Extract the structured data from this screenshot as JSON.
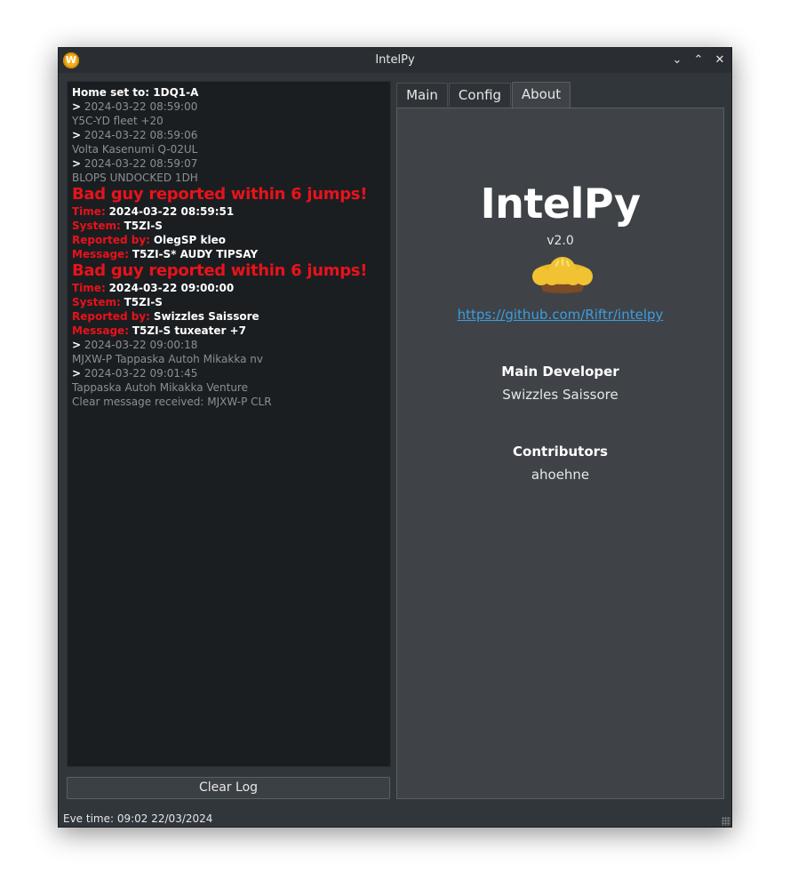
{
  "window": {
    "title": "IntelPy",
    "app_icon_letter": "W",
    "controls": {
      "minimize": "⌄",
      "maximize": "⌃",
      "close": "✕"
    }
  },
  "log": {
    "home_line": "Home set to: 1DQ1-A",
    "entries": [
      {
        "prefix": ">",
        "time": "2024-03-22 08:59:00",
        "text": "Y5C-YD fleet +20"
      },
      {
        "prefix": ">",
        "time": "2024-03-22 08:59:06",
        "text": "Volta Kasenumi Q-02UL"
      },
      {
        "prefix": ">",
        "time": "2024-03-22 08:59:07",
        "text": "BLOPS UNDOCKED 1DH"
      }
    ],
    "alerts": [
      {
        "heading": "Bad guy reported within 6 jumps!",
        "time_label": "Time:",
        "time": "2024-03-22 08:59:51",
        "system_label": "System:",
        "system": "T5ZI-S",
        "reported_label": "Reported by:",
        "reported": "OlegSP kleo",
        "message_label": "Message:",
        "message": "T5ZI-S* AUDY TIPSAY"
      },
      {
        "heading": "Bad guy reported within 6 jumps!",
        "time_label": "Time:",
        "time": "2024-03-22 09:00:00",
        "system_label": "System:",
        "system": "T5ZI-S",
        "reported_label": "Reported by:",
        "reported": "Swizzles Saissore",
        "message_label": "Message:",
        "message": "T5ZI-S tuxeater +7"
      }
    ],
    "entries_after": [
      {
        "prefix": ">",
        "time": "2024-03-22 09:00:18",
        "text": "MJXW-P Tappaska Autoh Mikakka nv"
      },
      {
        "prefix": ">",
        "time": "2024-03-22 09:01:45",
        "text": "Tappaska Autoh Mikakka Venture"
      }
    ],
    "clear_message": "Clear message received: MJXW-P CLR"
  },
  "clear_button": "Clear Log",
  "status": "Eve time: 09:02 22/03/2024",
  "tabs": [
    {
      "label": "Main"
    },
    {
      "label": "Config"
    },
    {
      "label": "About"
    }
  ],
  "about": {
    "title": "IntelPy",
    "version": "v2.0",
    "link": "https://github.com/Riftr/intelpy",
    "dev_heading": "Main Developer",
    "dev_name": "Swizzles Saissore",
    "contrib_heading": "Contributors",
    "contrib_name": "ahoehne"
  },
  "colors": {
    "window_bg": "#31363b",
    "log_bg": "#1b1e21",
    "alert_red": "#e8121b",
    "link_blue": "#3b9ee0"
  }
}
